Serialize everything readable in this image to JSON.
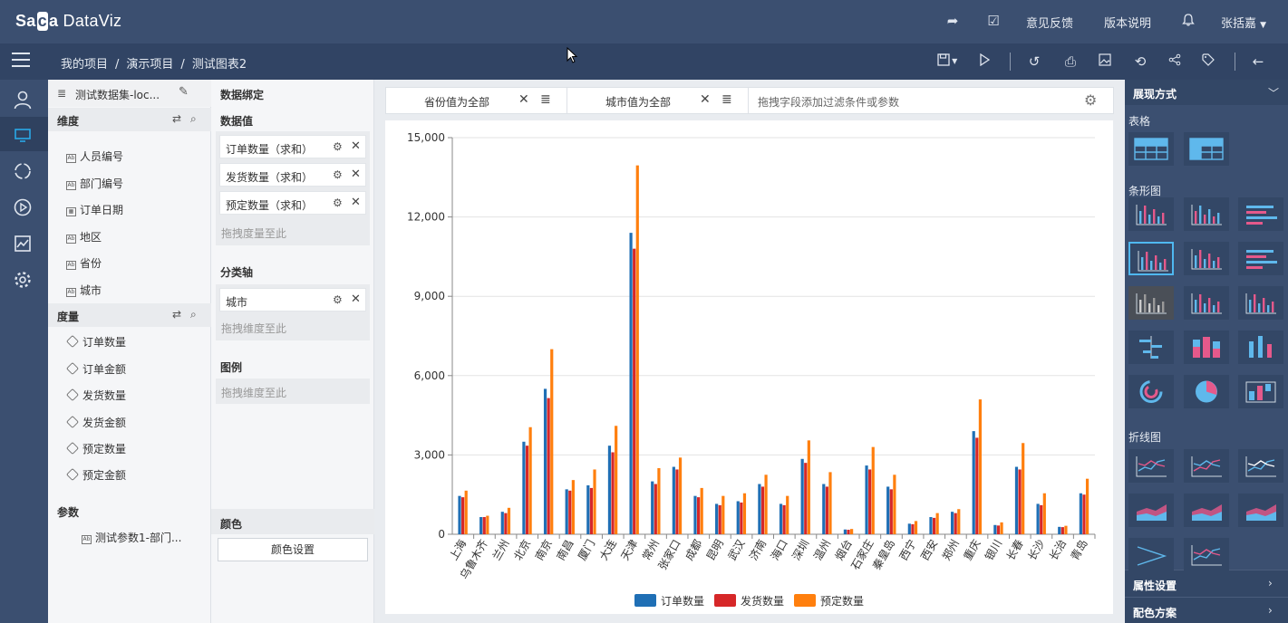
{
  "app": {
    "logo_part1": "Sa",
    "logo_part2": "a",
    "logo_part3": " DataViz",
    "feedback": "意见反馈",
    "version": "版本说明",
    "user": "张括嘉"
  },
  "breadcrumb": [
    "我的项目",
    "演示项目",
    "测试图表2"
  ],
  "dataset": {
    "name": "测试数据集-loc..."
  },
  "dimensions": {
    "title": "维度",
    "fields": [
      "人员编号",
      "部门编号",
      "订单日期",
      "地区",
      "省份",
      "城市"
    ]
  },
  "measures": {
    "title": "度量",
    "fields": [
      "订单数量",
      "订单金额",
      "发货数量",
      "发货金额",
      "预定数量",
      "预定金额"
    ]
  },
  "params": {
    "title": "参数",
    "fields": [
      "测试参数1-部门..."
    ]
  },
  "binding": {
    "title": "数据绑定",
    "values_title": "数据值",
    "values": [
      "订单数量（求和）",
      "发货数量（求和）",
      "预定数量（求和）"
    ],
    "values_hint": "拖拽度量至此",
    "axis_title": "分类轴",
    "axis": [
      "城市"
    ],
    "axis_hint": "拖拽维度至此",
    "legend_title": "图例",
    "legend_hint": "拖拽维度至此",
    "color_title": "颜色",
    "color_button": "颜色设置"
  },
  "filters": {
    "items": [
      "省份值为全部",
      "城市值为全部"
    ],
    "hint": "拖拽字段添加过滤条件或参数"
  },
  "right_panel": {
    "title": "展现方式",
    "sections": [
      "表格",
      "条形图",
      "折线图"
    ],
    "attr": "属性设置",
    "scheme": "配色方案"
  },
  "colors": {
    "s1": "#1f6fb5",
    "s2": "#d62728",
    "s3": "#ff7f0e"
  },
  "chart_data": {
    "type": "bar",
    "categories": [
      "上海",
      "乌鲁木齐",
      "兰州",
      "北京",
      "南京",
      "南昌",
      "厦门",
      "大连",
      "天津",
      "常州",
      "张家口",
      "成都",
      "昆明",
      "武汉",
      "济南",
      "海口",
      "深圳",
      "温州",
      "烟台",
      "石家庄",
      "秦皇岛",
      "西宁",
      "西安",
      "郑州",
      "重庆",
      "银川",
      "长春",
      "长沙",
      "长治",
      "青岛"
    ],
    "series": [
      {
        "name": "订单数量",
        "values": [
          1450,
          650,
          850,
          3500,
          5500,
          1700,
          1850,
          3350,
          11400,
          2000,
          2550,
          1450,
          1150,
          1250,
          1900,
          1150,
          2850,
          1900,
          180,
          2600,
          1800,
          400,
          650,
          850,
          3900,
          350,
          2550,
          1150,
          280,
          1550
        ]
      },
      {
        "name": "发货数量",
        "values": [
          1400,
          650,
          800,
          3350,
          5150,
          1650,
          1750,
          3100,
          10800,
          1900,
          2450,
          1400,
          1100,
          1200,
          1800,
          1100,
          2700,
          1800,
          170,
          2450,
          1700,
          380,
          620,
          800,
          3650,
          330,
          2450,
          1100,
          270,
          1500
        ]
      },
      {
        "name": "预定数量",
        "values": [
          1650,
          700,
          1000,
          4050,
          7000,
          2050,
          2450,
          4100,
          13950,
          2500,
          2900,
          1750,
          1450,
          1550,
          2250,
          1450,
          3550,
          2350,
          200,
          3300,
          2250,
          500,
          800,
          950,
          5100,
          450,
          3450,
          1550,
          320,
          2100
        ]
      }
    ],
    "yticks": [
      "0",
      "3,000",
      "6,000",
      "9,000",
      "12,000",
      "15,000"
    ],
    "ylim": [
      0,
      15000
    ],
    "grid": true,
    "legend": "bottom"
  }
}
